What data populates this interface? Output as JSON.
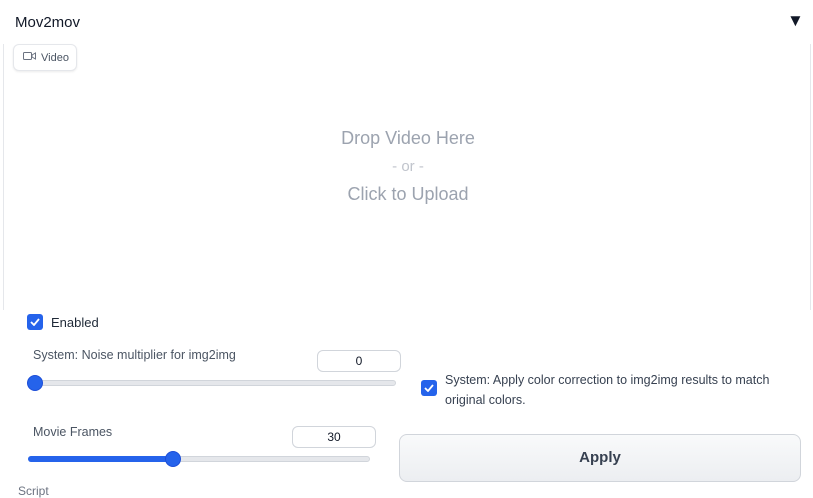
{
  "accordion": {
    "title": "Mov2mov",
    "toggle_icon": "triangle-down-icon"
  },
  "upload": {
    "tab_label": "Video",
    "tab_icon": "video-camera-icon",
    "line1": "Drop Video Here",
    "line2": "- or -",
    "line3": "Click to Upload"
  },
  "enabled": {
    "label": "Enabled",
    "checked": true
  },
  "noise": {
    "label": "System: Noise multiplier for img2img",
    "value": "0",
    "fraction": 0.0
  },
  "color_correction": {
    "label": "System: Apply color correction to img2img results to match original colors.",
    "checked": true
  },
  "frames": {
    "label": "Movie Frames",
    "value": "30",
    "fraction": 0.41
  },
  "apply": {
    "label": "Apply"
  },
  "next_label": "Script",
  "colors": {
    "accent": "#2563eb",
    "muted_text": "#9ca3af"
  }
}
